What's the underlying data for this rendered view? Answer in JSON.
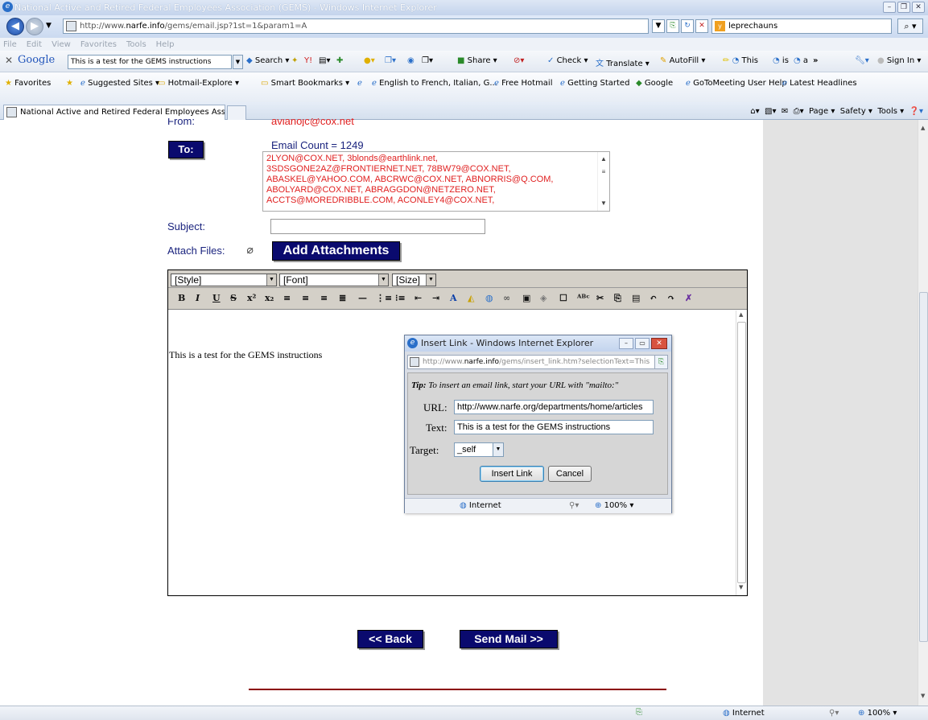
{
  "window": {
    "title": "National Active and Retired Federal Employees Association (GEMS) - Windows Internet Explorer"
  },
  "address_bar": {
    "url_prefix": "http://www.",
    "url_domain": "narfe.info",
    "url_suffix": "/gems/email.jsp?1st=1&param1=A",
    "search_value": "leprechauns"
  },
  "menu": {
    "items": [
      "File",
      "Edit",
      "View",
      "Favorites",
      "Tools",
      "Help"
    ]
  },
  "google_toolbar": {
    "brand": "Google",
    "search_value": "This is a test for the GEMS instructions",
    "search_label": "Search",
    "share_label": "Share",
    "check_label": "Check",
    "translate_label": "Translate",
    "autofill_label": "AutoFill",
    "this_label": "This",
    "is_label": "is",
    "a_label": "a",
    "more_label": "»",
    "signin_label": "Sign In"
  },
  "favorites_bar": {
    "favorites_label": "Favorites",
    "items": [
      "Suggested Sites",
      "Hotmail-Explore",
      "Smart Bookmarks",
      "English to French, Italian, G...",
      "Free Hotmail",
      "Getting Started",
      "Google",
      "GoToMeeting User Help",
      "Latest Headlines"
    ]
  },
  "tabs": {
    "active_tab": "National Active and Retired Federal Employees Associ...",
    "commands": [
      "Page",
      "Safety",
      "Tools"
    ]
  },
  "form": {
    "from_label": "From:",
    "from_value": "avianojc@cox.net",
    "to_button": "To:",
    "email_count": "Email Count = 1249",
    "recipients": [
      "2LYON@COX.NET, 3blonds@earthlink.net,",
      "3SDSGONE2AZ@FRONTIERNET.NET, 78BW79@COX.NET,",
      "ABASKEL@YAHOO.COM, ABCRWC@COX.NET, ABNORRIS@Q.COM,",
      "ABOLYARD@COX.NET, ABRAGGDON@NETZERO.NET,",
      "ACCTS@MOREDRIBBLE.COM, ACONLEY4@COX.NET,"
    ],
    "subject_label": "Subject:",
    "subject_value": "",
    "attach_label": "Attach Files:",
    "add_attachments": "Add Attachments"
  },
  "editor": {
    "style_select": "[Style]",
    "font_select": "[Font]",
    "size_select": "[Size]",
    "body_text": "This is a test for the GEMS instructions"
  },
  "popup": {
    "title": "Insert Link - Windows Internet Explorer",
    "url_prefix": "http://www.",
    "url_domain": "narfe.info",
    "url_suffix": "/gems/insert_link.htm?selectionText=This",
    "tip_label": "Tip:",
    "tip_text": "To insert an email link, start your URL with \"mailto:\"",
    "url_label": "URL:",
    "url_value": "http://www.narfe.org/departments/home/articles",
    "text_label": "Text:",
    "text_value": "This is a test for the GEMS instructions",
    "target_label": "Target:",
    "target_value": "_self",
    "insert_button": "Insert Link",
    "cancel_button": "Cancel",
    "status_zone": "Internet",
    "zoom": "100%"
  },
  "page_buttons": {
    "back": "<< Back",
    "send": "Send Mail >>"
  },
  "status_bar": {
    "zone": "Internet",
    "zoom": "100%"
  },
  "colors": {
    "navy_button": "#0a0a6e",
    "recipient_red": "#e02020",
    "divider_red": "#8b0000"
  }
}
